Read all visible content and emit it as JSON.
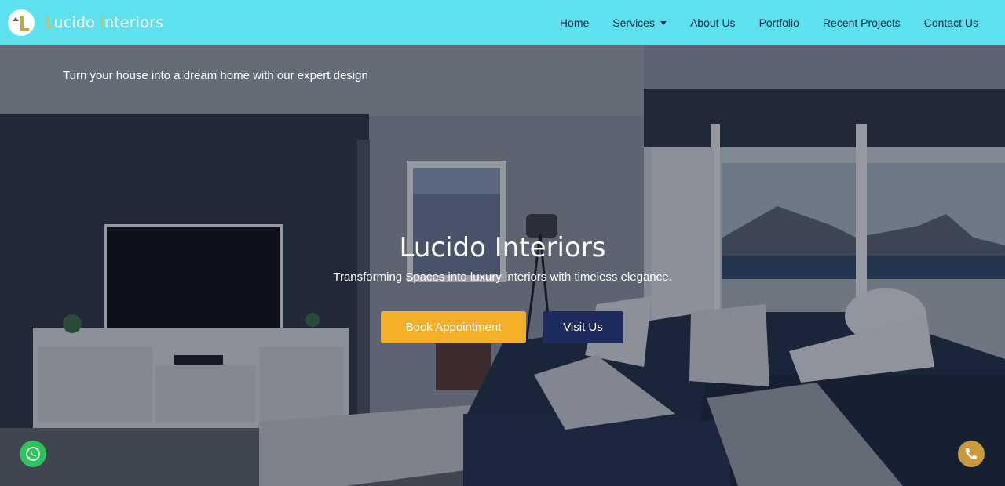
{
  "brand": {
    "first_initial": "L",
    "first_rest": "ucido ",
    "second_initial": "I",
    "second_rest": "nteriors"
  },
  "nav": {
    "home": "Home",
    "services": "Services",
    "about": "About Us",
    "portfolio": "Portfolio",
    "recent_projects": "Recent Projects",
    "contact": "Contact Us"
  },
  "hero": {
    "tagline": "Turn your house into a dream home with our expert design",
    "title": "Lucido Interiors",
    "subtitle": "Transforming Spaces into luxury interiors with timeless elegance.",
    "book_label": "Book Appointment",
    "visit_label": "Visit Us"
  },
  "colors": {
    "navbar": "#5ee1ee",
    "accent": "#f5b02a",
    "visit_button": "#1f2b5e",
    "whatsapp": "#2cc45b",
    "phone": "#c99a3b"
  },
  "icons": {
    "whatsapp": "whatsapp-icon",
    "phone": "phone-icon",
    "logo": "logo-icon"
  }
}
